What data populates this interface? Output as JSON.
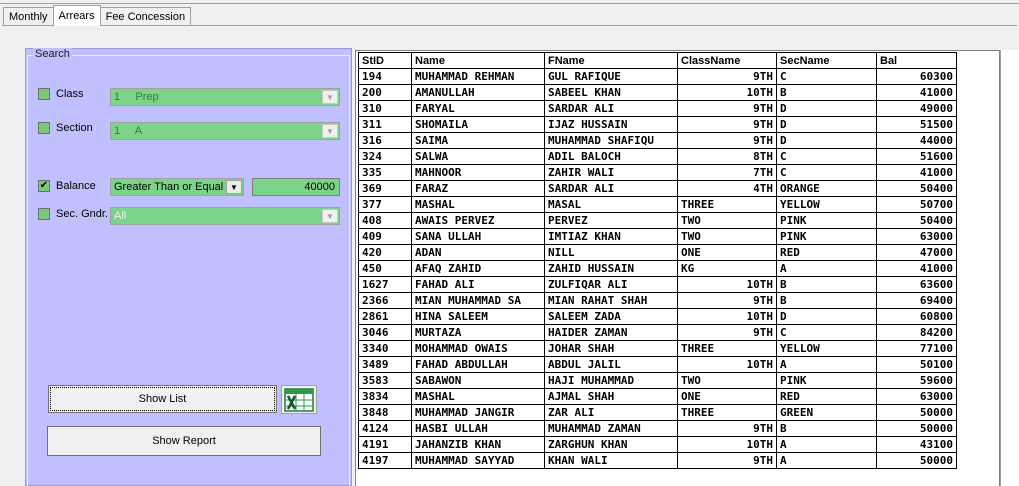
{
  "tabs": [
    {
      "label": "Monthly"
    },
    {
      "label": "Arrears"
    },
    {
      "label": "Fee Concession"
    }
  ],
  "search": {
    "title": "Search",
    "class": {
      "label": "Class",
      "checked": false,
      "value": "1     Prep"
    },
    "section": {
      "label": "Section",
      "checked": false,
      "value": "1     A"
    },
    "balance": {
      "label": "Balance",
      "checked": true,
      "check_glyph": "✔",
      "operator": "Greater Than or Equal",
      "amount": "40000"
    },
    "sec_gndr": {
      "label": "Sec. Gndr.",
      "checked": false,
      "value": "All"
    }
  },
  "buttons": {
    "show_list": "Show List",
    "show_report": "Show Report"
  },
  "grid": {
    "columns": [
      "StID",
      "Name",
      "FName",
      "ClassName",
      "SecName",
      "Bal"
    ],
    "rows": [
      [
        "194",
        "MUHAMMAD REHMAN",
        "GUL RAFIQUE",
        "9TH",
        "C",
        "60300"
      ],
      [
        "200",
        "AMANULLAH",
        "SABEEL KHAN",
        "10TH",
        "B",
        "41000"
      ],
      [
        "310",
        "FARYAL",
        "SARDAR ALI",
        "9TH",
        "D",
        "49000"
      ],
      [
        "311",
        "SHOMAILA",
        "IJAZ HUSSAIN",
        "9TH",
        "D",
        "51500"
      ],
      [
        "316",
        "SAIMA",
        "MUHAMMAD SHAFIQU",
        "9TH",
        "D",
        "44000"
      ],
      [
        "324",
        "SALWA",
        "ADIL BALOCH",
        "8TH",
        "C",
        "51600"
      ],
      [
        "335",
        "MAHNOOR",
        "ZAHIR WALI",
        "7TH",
        "C",
        "41000"
      ],
      [
        "369",
        "FARAZ",
        "SARDAR ALI",
        "4TH",
        "ORANGE",
        "50400"
      ],
      [
        "377",
        "MASHAL",
        "MASAL",
        "THREE",
        "YELLOW",
        "50700"
      ],
      [
        "408",
        "AWAIS PERVEZ",
        "PERVEZ",
        "TWO",
        "PINK",
        "50400"
      ],
      [
        "409",
        "SANA ULLAH",
        "IMTIAZ KHAN",
        "TWO",
        "PINK",
        "63000"
      ],
      [
        "420",
        "ADAN",
        "NILL",
        "ONE",
        "RED",
        "47000"
      ],
      [
        "450",
        "AFAQ ZAHID",
        "ZAHID HUSSAIN",
        "KG",
        "A",
        "41000"
      ],
      [
        "1627",
        "FAHAD ALI",
        "ZULFIQAR ALI",
        "10TH",
        "B",
        "63600"
      ],
      [
        "2366",
        "MIAN MUHAMMAD SA",
        "MIAN RAHAT SHAH",
        "9TH",
        "B",
        "69400"
      ],
      [
        "2861",
        "HINA SALEEM",
        "SALEEM ZADA",
        "10TH",
        "D",
        "60800"
      ],
      [
        "3046",
        "MURTAZA",
        "HAIDER ZAMAN",
        "9TH",
        "C",
        "84200"
      ],
      [
        "3340",
        "MOHAMMAD OWAIS",
        "JOHAR SHAH",
        "THREE",
        "YELLOW",
        "77100"
      ],
      [
        "3489",
        "FAHAD ABDULLAH",
        "ABDUL JALIL",
        "10TH",
        "A",
        "50100"
      ],
      [
        "3583",
        "SABAWON",
        "HAJI MUHAMMAD",
        "TWO",
        "PINK",
        "59600"
      ],
      [
        "3834",
        "MASHAL",
        "AJMAL SHAH",
        "ONE",
        "RED",
        "63000"
      ],
      [
        "3848",
        "MUHAMMAD JANGIR",
        "ZAR ALI",
        "THREE",
        "GREEN",
        "50000"
      ],
      [
        "4124",
        "HASBI ULLAH",
        "MUHAMMAD ZAMAN",
        "9TH",
        "B",
        "50000"
      ],
      [
        "4191",
        "JAHANZIB KHAN",
        "ZARGHUN KHAN",
        "10TH",
        "A",
        "43100"
      ],
      [
        "4197",
        "MUHAMMAD SAYYAD",
        "KHAN WALI",
        "9TH",
        "A",
        "50000"
      ]
    ]
  },
  "icons": {
    "combo_arrow": "▼",
    "excel": "excel-export-icon"
  },
  "colors": {
    "panel": "#c0c0ff",
    "field": "#7cd48a"
  }
}
